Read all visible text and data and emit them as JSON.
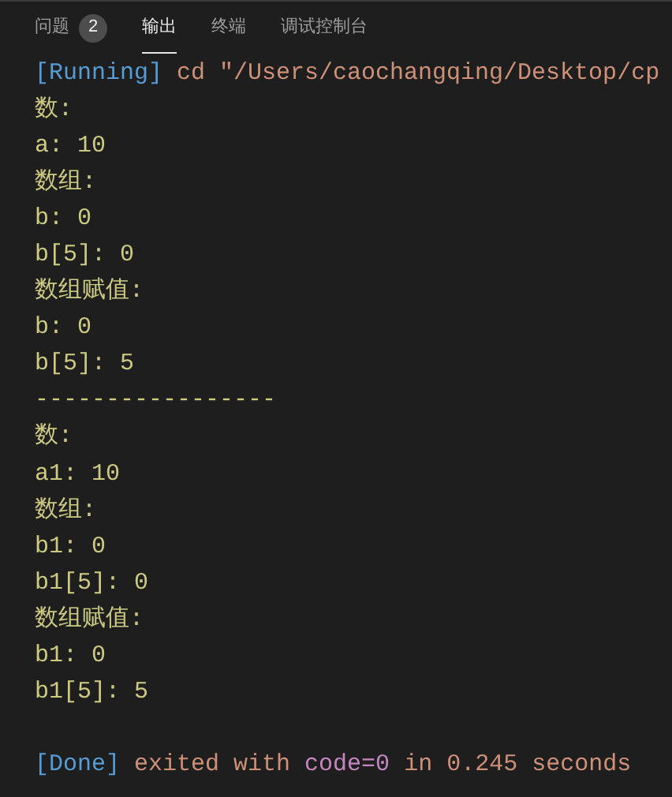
{
  "tabs": [
    {
      "label": "问题",
      "badge": "2",
      "selected": false
    },
    {
      "label": "输出",
      "selected": true
    },
    {
      "label": "终端",
      "selected": false
    },
    {
      "label": "调试控制台",
      "selected": false
    }
  ],
  "output": [
    {
      "segments": [
        {
          "kind": "tag",
          "text": "[Running]"
        },
        {
          "kind": "command",
          "text": " cd \"/Users/caochangqing/Desktop/cp"
        }
      ]
    },
    {
      "segments": [
        {
          "kind": "plain",
          "text": "数:"
        }
      ]
    },
    {
      "segments": [
        {
          "kind": "plain",
          "text": "a: 10"
        }
      ]
    },
    {
      "segments": [
        {
          "kind": "plain",
          "text": "数组:"
        }
      ]
    },
    {
      "segments": [
        {
          "kind": "plain",
          "text": "b: 0"
        }
      ]
    },
    {
      "segments": [
        {
          "kind": "plain",
          "text": "b[5]: 0"
        }
      ]
    },
    {
      "segments": [
        {
          "kind": "plain",
          "text": "数组赋值:"
        }
      ]
    },
    {
      "segments": [
        {
          "kind": "plain",
          "text": "b: 0"
        }
      ]
    },
    {
      "segments": [
        {
          "kind": "plain",
          "text": "b[5]: 5"
        }
      ]
    },
    {
      "segments": [
        {
          "kind": "plain",
          "text": "-----------------"
        }
      ]
    },
    {
      "segments": [
        {
          "kind": "plain",
          "text": "数:"
        }
      ]
    },
    {
      "segments": [
        {
          "kind": "plain",
          "text": "a1: 10"
        }
      ]
    },
    {
      "segments": [
        {
          "kind": "plain",
          "text": "数组:"
        }
      ]
    },
    {
      "segments": [
        {
          "kind": "plain",
          "text": "b1: 0"
        }
      ]
    },
    {
      "segments": [
        {
          "kind": "plain",
          "text": "b1[5]: 0"
        }
      ]
    },
    {
      "segments": [
        {
          "kind": "plain",
          "text": "数组赋值:"
        }
      ]
    },
    {
      "segments": [
        {
          "kind": "plain",
          "text": "b1: 0"
        }
      ]
    },
    {
      "segments": [
        {
          "kind": "plain",
          "text": "b1[5]: 5"
        }
      ]
    },
    {
      "gap_before": true,
      "segments": [
        {
          "kind": "tag",
          "text": "[Done]"
        },
        {
          "kind": "command",
          "text": " exited with "
        },
        {
          "kind": "code",
          "text": "code=0"
        },
        {
          "kind": "command",
          "text": " in 0.245 seconds"
        }
      ]
    }
  ]
}
